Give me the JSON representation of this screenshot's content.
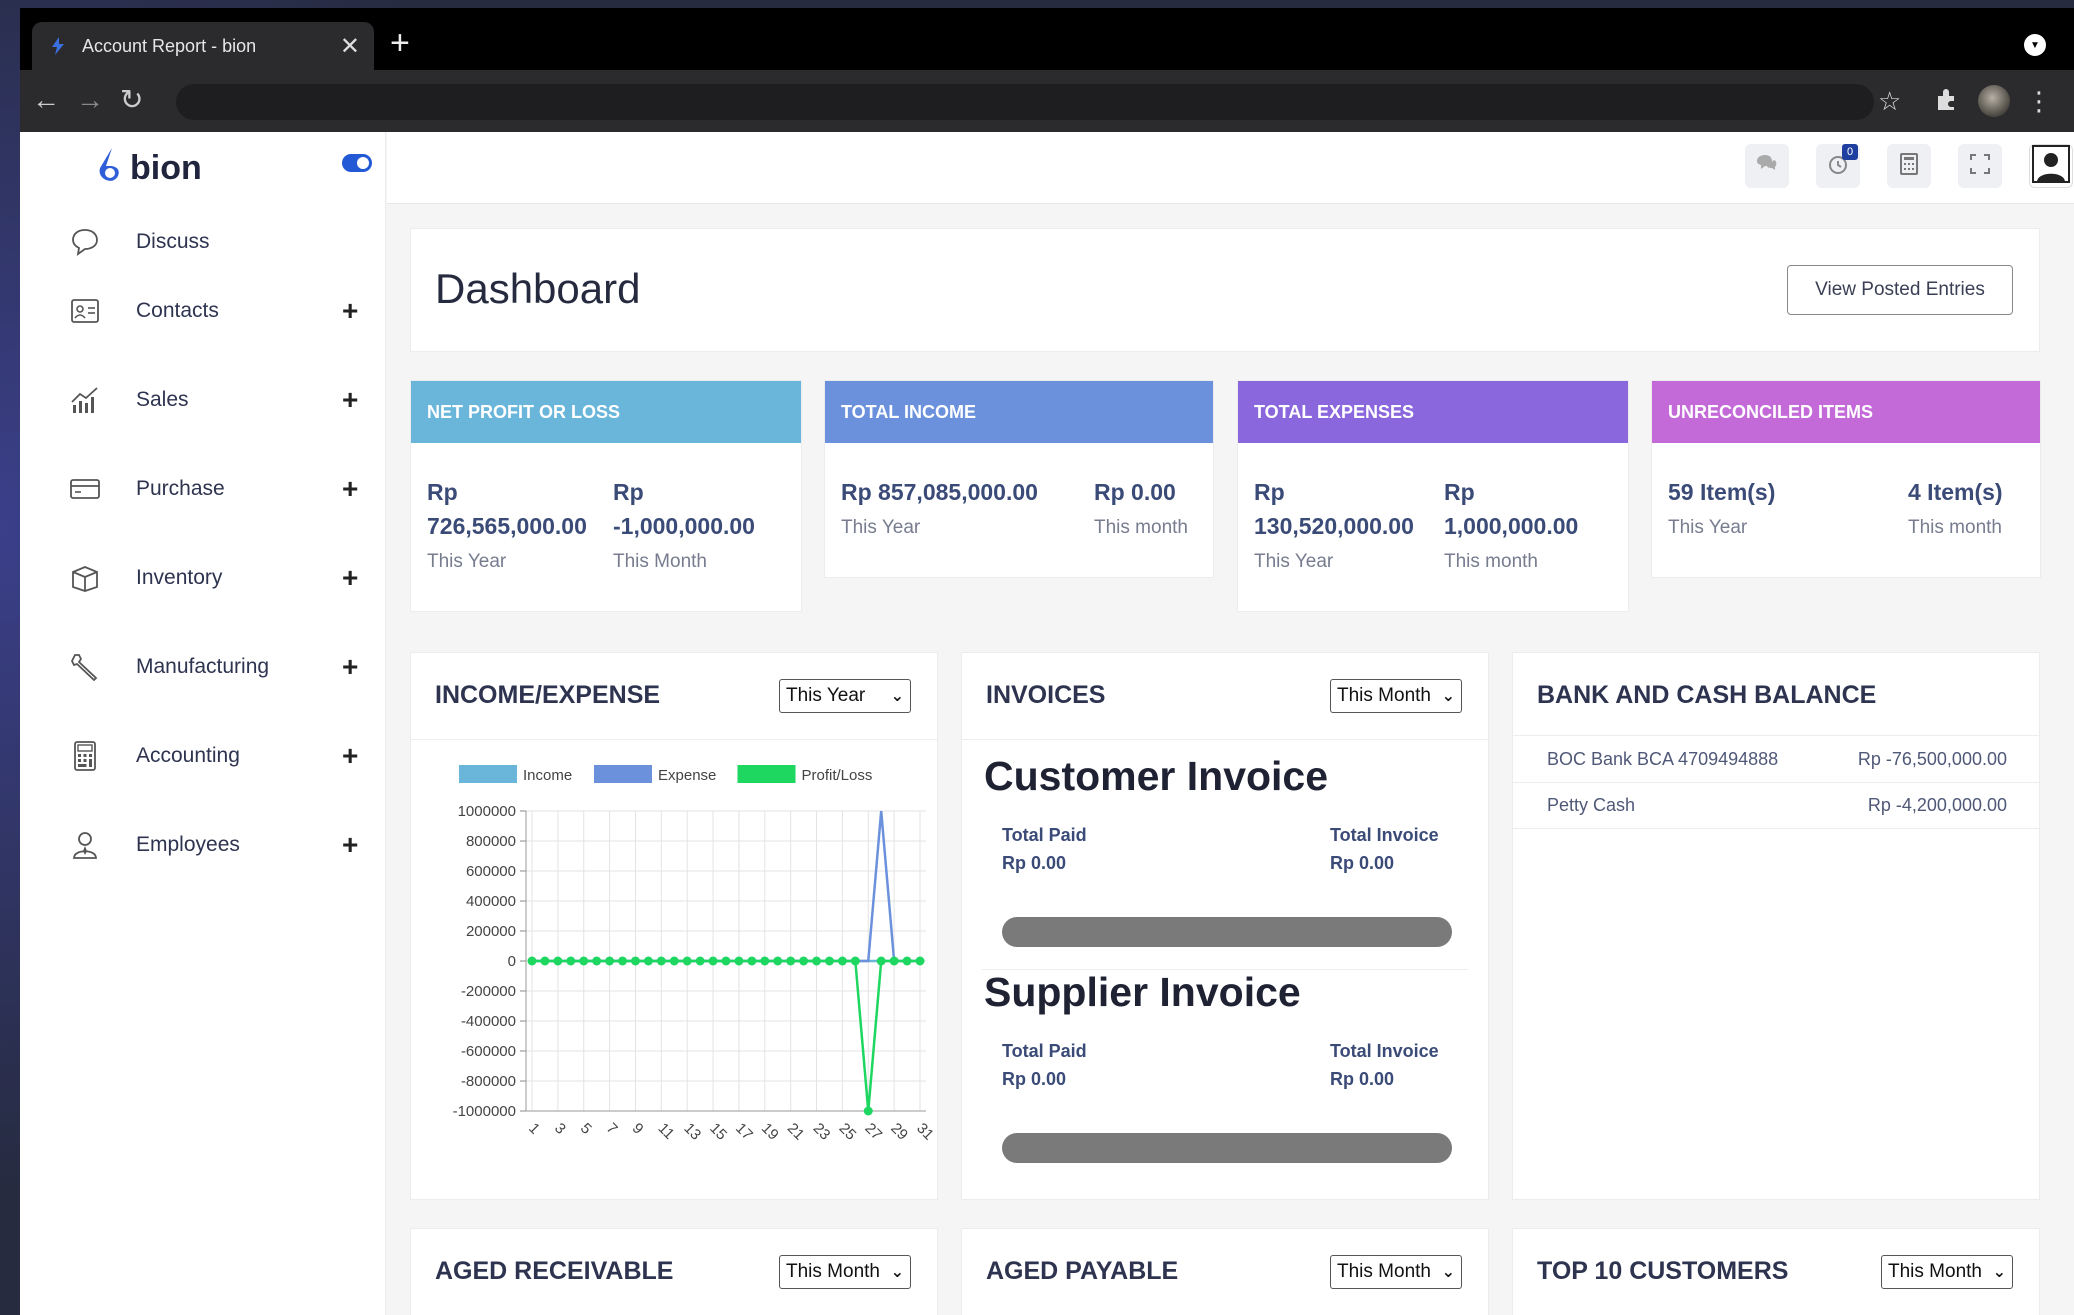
{
  "browser": {
    "tab_title": "Account Report - bion",
    "close_glyph": "✕",
    "new_tab_glyph": "+"
  },
  "sidebar": {
    "brand": "bion",
    "items": [
      {
        "label": "Discuss",
        "icon": "chat-icon",
        "expandable": false
      },
      {
        "label": "Contacts",
        "icon": "contact-card-icon",
        "expandable": true
      },
      {
        "label": "Sales",
        "icon": "bar-chart-icon",
        "expandable": true
      },
      {
        "label": "Purchase",
        "icon": "credit-card-icon",
        "expandable": true
      },
      {
        "label": "Inventory",
        "icon": "box-icon",
        "expandable": true
      },
      {
        "label": "Manufacturing",
        "icon": "wrench-icon",
        "expandable": true
      },
      {
        "label": "Accounting",
        "icon": "calculator-icon",
        "expandable": true
      },
      {
        "label": "Employees",
        "icon": "employee-icon",
        "expandable": true
      }
    ],
    "plus": "+"
  },
  "topbar": {
    "notification_count": "0"
  },
  "dashboard": {
    "title": "Dashboard",
    "view_posted": "View Posted Entries"
  },
  "stats": [
    {
      "header": "NET PROFIT OR LOSS",
      "color": "#6ab6db",
      "a_cur": "Rp",
      "a_val": "726,565,000.00",
      "a_sub": "This Year",
      "b_cur": "Rp",
      "b_val": "-1,000,000.00",
      "b_sub": "This Month"
    },
    {
      "header": "TOTAL INCOME",
      "color": "#6b91dc",
      "a_val": "Rp 857,085,000.00",
      "a_sub": "This Year",
      "b_val": "Rp 0.00",
      "b_sub": "This month"
    },
    {
      "header": "TOTAL EXPENSES",
      "color": "#8a67dc",
      "a_cur": "Rp",
      "a_val": "130,520,000.00",
      "a_sub": "This Year",
      "b_cur": "Rp",
      "b_val": "1,000,000.00",
      "b_sub": "This month"
    },
    {
      "header": "UNRECONCILED ITEMS",
      "color": "#c36ad8",
      "a_val": "59 Item(s)",
      "a_sub": "This Year",
      "b_val": "4 Item(s)",
      "b_sub": "This month"
    }
  ],
  "income_expense": {
    "title": "INCOME/EXPENSE",
    "period": "This Year"
  },
  "invoices": {
    "title": "INVOICES",
    "period": "This Month",
    "customer": {
      "title": "Customer Invoice",
      "paid_label": "Total Paid",
      "paid_value": "Rp 0.00",
      "total_label": "Total Invoice",
      "total_value": "Rp 0.00"
    },
    "supplier": {
      "title": "Supplier Invoice",
      "paid_label": "Total Paid",
      "paid_value": "Rp 0.00",
      "total_label": "Total Invoice",
      "total_value": "Rp 0.00"
    }
  },
  "bank": {
    "title": "BANK AND CASH BALANCE",
    "rows": [
      {
        "name": "BOC Bank BCA 4709494888",
        "amount": "Rp -76,500,000.00"
      },
      {
        "name": "Petty Cash",
        "amount": "Rp -4,200,000.00"
      }
    ]
  },
  "bottom": {
    "aged_receivable": {
      "title": "AGED RECEIVABLE",
      "period": "This Month"
    },
    "aged_payable": {
      "title": "AGED PAYABLE",
      "period": "This Month"
    },
    "top_customers": {
      "title": "TOP 10 CUSTOMERS",
      "period": "This Month"
    }
  },
  "chart_data": {
    "type": "line",
    "legend_position": "top",
    "grid": true,
    "ylim": [
      -1000000,
      1000000
    ],
    "yticks": [
      "1000000",
      "800000",
      "600000",
      "400000",
      "200000",
      "0",
      "-200000",
      "-400000",
      "-600000",
      "-800000",
      "-1000000"
    ],
    "x": [
      1,
      2,
      3,
      4,
      5,
      6,
      7,
      8,
      9,
      10,
      11,
      12,
      13,
      14,
      15,
      16,
      17,
      18,
      19,
      20,
      21,
      22,
      23,
      24,
      25,
      26,
      27,
      28,
      29,
      30,
      31
    ],
    "xticks": [
      "1",
      "3",
      "5",
      "7",
      "9",
      "11",
      "13",
      "15",
      "17",
      "19",
      "21",
      "23",
      "25",
      "27",
      "29",
      "31"
    ],
    "series": [
      {
        "name": "Income",
        "color": "#6ab6db",
        "values": [
          0,
          0,
          0,
          0,
          0,
          0,
          0,
          0,
          0,
          0,
          0,
          0,
          0,
          0,
          0,
          0,
          0,
          0,
          0,
          0,
          0,
          0,
          0,
          0,
          0,
          0,
          0,
          0,
          0,
          0,
          0
        ]
      },
      {
        "name": "Expense",
        "color": "#6b91dc",
        "values": [
          0,
          0,
          0,
          0,
          0,
          0,
          0,
          0,
          0,
          0,
          0,
          0,
          0,
          0,
          0,
          0,
          0,
          0,
          0,
          0,
          0,
          0,
          0,
          0,
          0,
          0,
          0,
          1000000,
          0,
          0,
          0
        ]
      },
      {
        "name": "Profit/Loss",
        "color": "#1ed760",
        "values": [
          0,
          0,
          0,
          0,
          0,
          0,
          0,
          0,
          0,
          0,
          0,
          0,
          0,
          0,
          0,
          0,
          0,
          0,
          0,
          0,
          0,
          0,
          0,
          0,
          0,
          0,
          -1000000,
          0,
          0,
          0,
          0
        ]
      }
    ]
  }
}
